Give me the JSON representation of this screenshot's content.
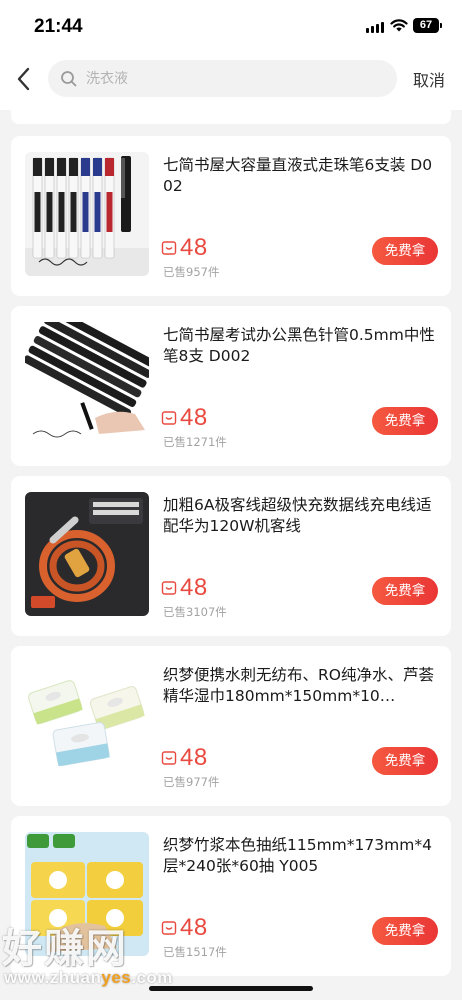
{
  "status": {
    "time": "21:44",
    "battery": "67"
  },
  "search": {
    "placeholder": "洗衣液",
    "cancel_label": "取消"
  },
  "colors": {
    "price": "#e94a40",
    "button": "#ea3636"
  },
  "products": [
    {
      "title": "七简书屋大容量直液式走珠笔6支装 D002",
      "price": "48",
      "sold": "已售957件",
      "button": "免费拿",
      "image": "gel-pens-black-blue"
    },
    {
      "title": "七简书屋考试办公黑色针管0.5mm中性笔8支 D002",
      "price": "48",
      "sold": "已售1271件",
      "button": "免费拿",
      "image": "black-gel-pens-writing"
    },
    {
      "title": "加粗6A极客线超级快充数据线充电线适配华为120W机客线",
      "price": "48",
      "sold": "已售3107件",
      "button": "免费拿",
      "image": "orange-usb-cable"
    },
    {
      "title": "织梦便携水刺无纺布、RO纯净水、芦荟精华湿巾180mm*150mm*10…",
      "price": "48",
      "sold": "已售977件",
      "button": "免费拿",
      "image": "wet-wipes-packs"
    },
    {
      "title": "织梦竹浆本色抽纸115mm*173mm*4层*240张*60抽 Y005",
      "price": "48",
      "sold": "已售1517件",
      "button": "免费拿",
      "image": "bamboo-tissue-packs"
    }
  ],
  "watermark": {
    "text": "好赚网",
    "url_prefix": "www.zhuan",
    "url_highlight": "yes",
    "url_suffix": ".com"
  }
}
